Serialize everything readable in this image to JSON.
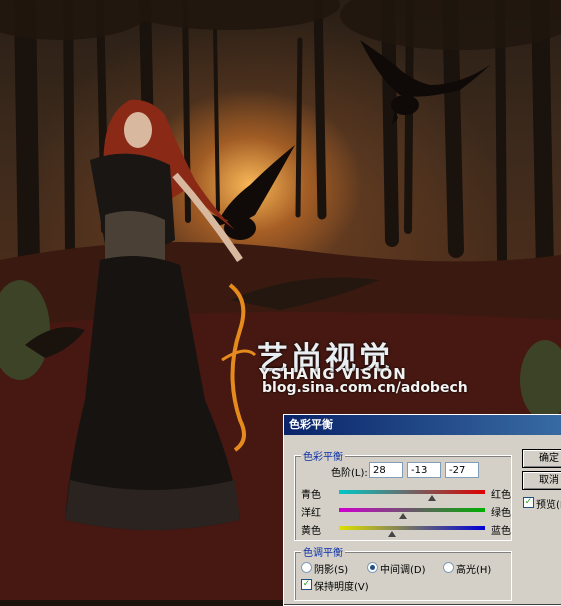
{
  "watermark": {
    "brand_cn": "艺尚视觉",
    "brand_en": "YSHANG VISION",
    "url": "blog.sina.com.cn/adobech"
  },
  "dialog": {
    "title": "色彩平衡",
    "color_balance_group": "色彩平衡",
    "levels_label": "色阶(L):",
    "levels_values": [
      "28",
      "-13",
      "-27"
    ],
    "sliders": [
      {
        "left": "青色",
        "right": "红色",
        "value": 28,
        "left_color": "#00c8c8",
        "right_color": "#e00000"
      },
      {
        "left": "洋红",
        "right": "绿色",
        "value": -13,
        "left_color": "#d000d0",
        "right_color": "#00b000"
      },
      {
        "left": "黄色",
        "right": "蓝色",
        "value": -27,
        "left_color": "#e0e000",
        "right_color": "#0000d8"
      }
    ],
    "tone_group": "色调平衡",
    "tone_options": [
      {
        "label": "阴影(S)",
        "selected": false
      },
      {
        "label": "中间调(D)",
        "selected": true
      },
      {
        "label": "高光(H)",
        "selected": false
      }
    ],
    "preserve_luminosity": "保持明度(V)",
    "preserve_checked": true,
    "ok_button": "确定",
    "cancel_button": "取消",
    "preview_label": "预览(P)",
    "preview_checked": true
  }
}
